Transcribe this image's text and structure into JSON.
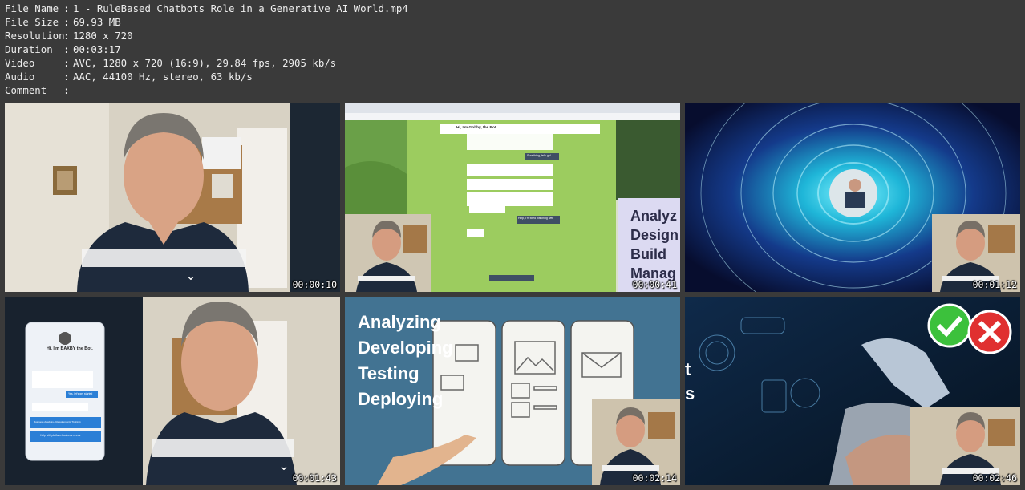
{
  "metadata": [
    {
      "key": "File Name",
      "value": "1 - RuleBased Chatbots Role in a Generative AI World.mp4"
    },
    {
      "key": "File Size",
      "value": "69.93 MB"
    },
    {
      "key": "Resolution",
      "value": "1280 x 720"
    },
    {
      "key": "Duration",
      "value": "00:03:17"
    },
    {
      "key": "Video",
      "value": "AVC, 1280 x 720 (16:9), 29.84 fps, 2905 kb/s"
    },
    {
      "key": "Audio",
      "value": "AAC, 44100 Hz, stereo, 63 kb/s"
    },
    {
      "key": "Comment",
      "value": ""
    }
  ],
  "separator": ":",
  "thumbnails": [
    {
      "timestamp": "00:00:10"
    },
    {
      "timestamp": "00:00:41",
      "chat_title": "Hi, I'm Golfby, the Bot.",
      "chat_button_1": "Sure thing, let's go!",
      "chat_button_2": "Help, I'm fixed watching web",
      "slide_words": [
        "Analyz",
        "Design",
        "Build",
        "Manag"
      ]
    },
    {
      "timestamp": "00:01:12"
    },
    {
      "timestamp": "00:01:43",
      "bot_title": "Hi, I'm BAXBY the Bot.",
      "bot_reply": "Yes, let's get started",
      "bot_btn_1": "Business Analysis / Requirements Training",
      "bot_btn_2": "Help with platform business needs"
    },
    {
      "timestamp": "00:02:14",
      "words": [
        "Analyzing",
        "Developing",
        "Testing",
        "Deploying"
      ]
    },
    {
      "timestamp": "00:02:46",
      "side_letters": [
        "t",
        "s"
      ]
    }
  ],
  "colors": {
    "background": "#3a3a3a",
    "text": "#ededed",
    "check": "#3cc13c",
    "cross": "#e03030"
  }
}
